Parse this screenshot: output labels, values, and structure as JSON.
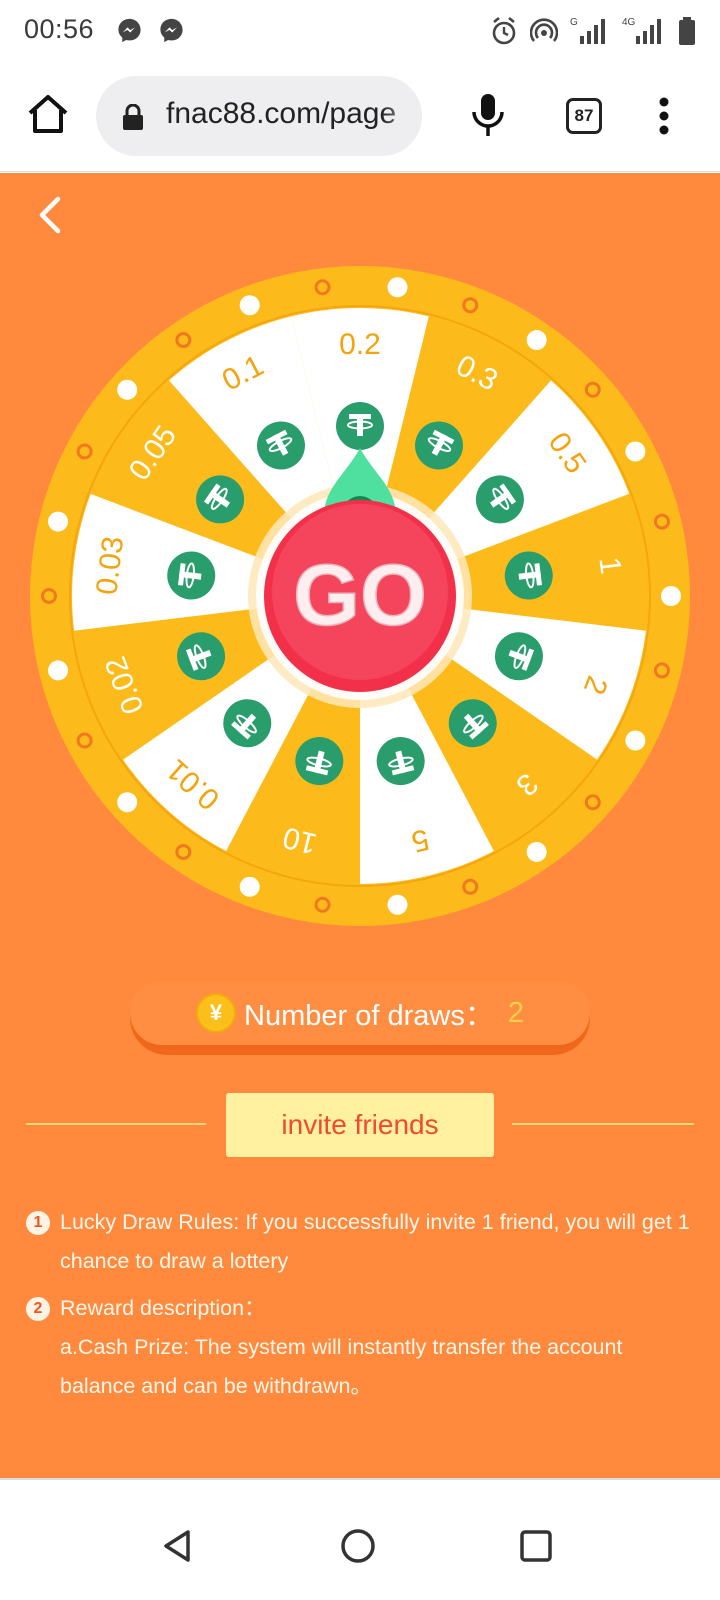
{
  "status": {
    "time": "00:56",
    "battery_level": 0.85
  },
  "browser": {
    "url": "fnac88.com/page",
    "tab_count": "87"
  },
  "wheel": {
    "center_label": "GO",
    "segments": [
      "0.2",
      "0.3",
      "0.5",
      "1",
      "2",
      "3",
      "5",
      "10",
      "0.01",
      "0.02",
      "0.03",
      "0.05",
      "0.1"
    ],
    "coin_icon": "tether-icon",
    "colors": {
      "rim": "#fdbb1b",
      "segment_yellow": "#fdbb1b",
      "segment_white": "#ffffff",
      "coin": "#2a9d6c",
      "go_button": "#f2304a",
      "pointer": "#4fe0a0",
      "label_yellow": "#f5a20c"
    }
  },
  "draws": {
    "label": "Number of draws：",
    "value": "2",
    "coin_symbol": "¥"
  },
  "invite": {
    "label": "invite friends"
  },
  "rules": [
    {
      "num": "1",
      "text": "Lucky Draw Rules: If you successfully invite 1 friend, you will get 1 chance to draw a lottery"
    },
    {
      "num": "2",
      "text": "Reward description：",
      "detail": "a.Cash Prize: The system will instantly transfer the account balance and can be withdrawn。"
    }
  ]
}
